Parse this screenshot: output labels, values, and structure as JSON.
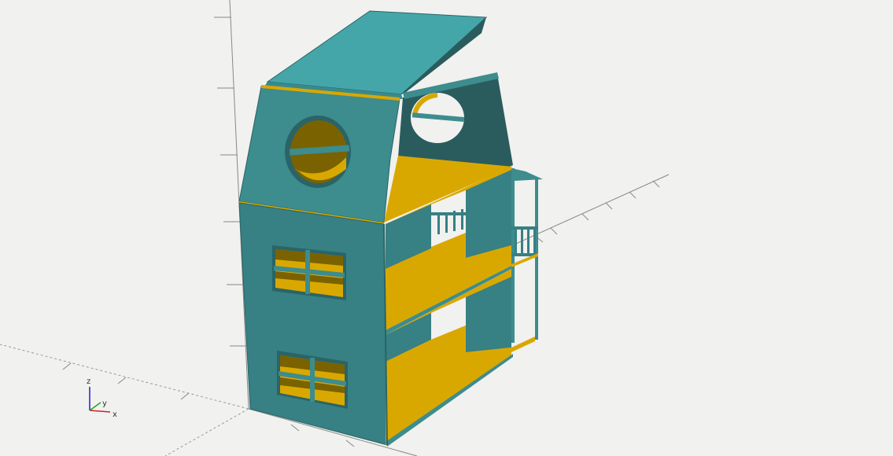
{
  "viewport": {
    "background": "#f1f1ef"
  },
  "axes_indicator": {
    "x_label": "x",
    "y_label": "y",
    "z_label": "z",
    "x_color": "#d02020",
    "y_color": "#20a020",
    "z_color": "#2020d0"
  },
  "model": {
    "name": "dollhouse",
    "face_color": "#3d8c8e",
    "face_light": "#45a6aa",
    "face_dark": "#2a5c5e",
    "interior_color": "#d9a800",
    "window_interior": "#7a6200"
  }
}
